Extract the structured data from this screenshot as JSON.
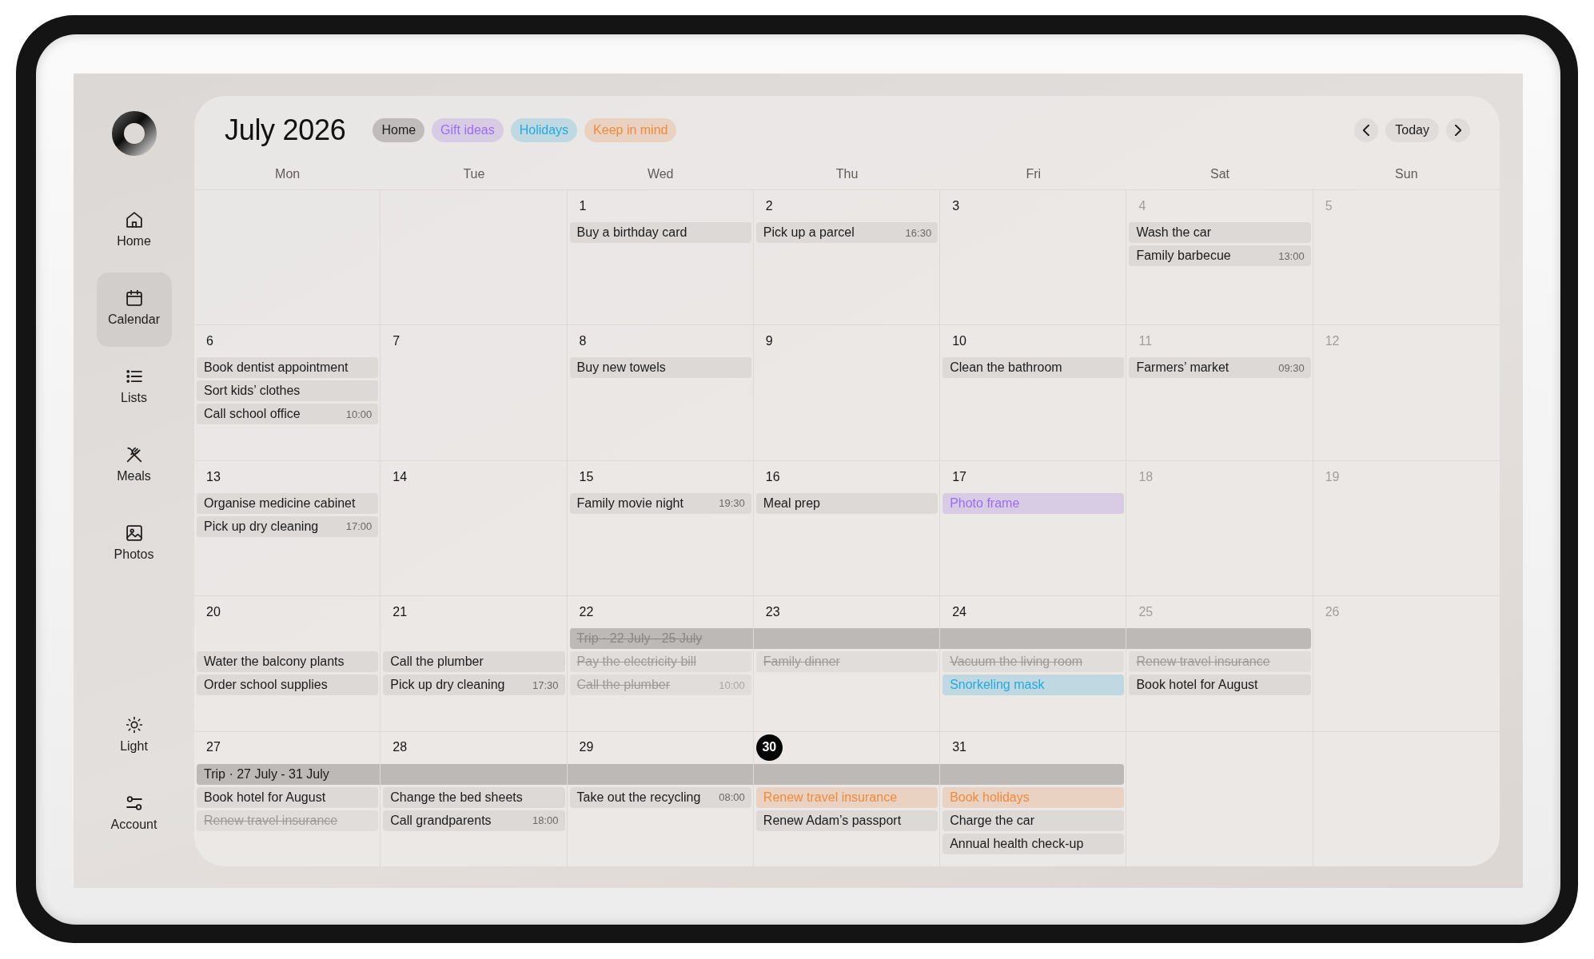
{
  "sidebar": {
    "items": [
      {
        "label": "Home",
        "selected": false
      },
      {
        "label": "Calendar",
        "selected": true
      },
      {
        "label": "Lists",
        "selected": false
      },
      {
        "label": "Meals",
        "selected": false
      },
      {
        "label": "Photos",
        "selected": false
      }
    ],
    "footer_items": [
      {
        "label": "Light"
      },
      {
        "label": "Account"
      }
    ]
  },
  "header": {
    "title": "July 2026",
    "categories": [
      {
        "label": "Home",
        "color": "#1d1d1d"
      },
      {
        "label": "Gift ideas",
        "color": "#9b6cf3"
      },
      {
        "label": "Holidays",
        "color": "#22aadf"
      },
      {
        "label": "Keep in mind",
        "color": "#f08a3c"
      }
    ],
    "today_button": "Today"
  },
  "calendar": {
    "weekdays": [
      "Mon",
      "Tue",
      "Wed",
      "Thu",
      "Fri",
      "Sat",
      "Sun"
    ],
    "weeks": [
      {
        "days": [
          {
            "kind": "blank"
          },
          {
            "kind": "blank"
          },
          {
            "kind": "day",
            "number": "1",
            "weekend": false,
            "today": false,
            "events": [
              {
                "title": "Buy a birthday card",
                "done": false
              }
            ]
          },
          {
            "kind": "day",
            "number": "2",
            "weekend": false,
            "today": false,
            "events": [
              {
                "title": "Pick up a parcel",
                "time": "16:30",
                "done": false
              }
            ]
          },
          {
            "kind": "day",
            "number": "3",
            "weekend": false,
            "today": false
          },
          {
            "kind": "day",
            "number": "4",
            "weekend": true,
            "today": false,
            "events": [
              {
                "title": "Wash the car",
                "done": false
              },
              {
                "title": "Family barbecue",
                "time": "13:00",
                "done": false
              }
            ]
          },
          {
            "kind": "day",
            "number": "5",
            "weekend": true,
            "today": false
          }
        ]
      },
      {
        "days": [
          {
            "kind": "day",
            "number": "6",
            "weekend": false,
            "today": false,
            "events": [
              {
                "title": "Book dentist appointment",
                "done": false
              },
              {
                "title": "Sort kids’ clothes",
                "done": false
              },
              {
                "title": "Call school office",
                "time": "10:00",
                "done": false
              }
            ]
          },
          {
            "kind": "day",
            "number": "7",
            "weekend": false,
            "today": false
          },
          {
            "kind": "day",
            "number": "8",
            "weekend": false,
            "today": false,
            "events": [
              {
                "title": "Buy new towels",
                "done": false
              }
            ]
          },
          {
            "kind": "day",
            "number": "9",
            "weekend": false,
            "today": false
          },
          {
            "kind": "day",
            "number": "10",
            "weekend": false,
            "today": false,
            "events": [
              {
                "title": "Clean the bathroom",
                "done": false
              }
            ]
          },
          {
            "kind": "day",
            "number": "11",
            "weekend": true,
            "today": false,
            "events": [
              {
                "title": "Farmers’ market",
                "time": "09:30",
                "done": false
              }
            ]
          },
          {
            "kind": "day",
            "number": "12",
            "weekend": true,
            "today": false
          }
        ]
      },
      {
        "days": [
          {
            "kind": "day",
            "number": "13",
            "weekend": false,
            "today": false,
            "events": [
              {
                "title": "Organise medicine cabinet",
                "done": false
              },
              {
                "title": "Pick up dry cleaning",
                "time": "17:00",
                "done": false
              }
            ]
          },
          {
            "kind": "day",
            "number": "14",
            "weekend": false,
            "today": false
          },
          {
            "kind": "day",
            "number": "15",
            "weekend": false,
            "today": false,
            "events": [
              {
                "title": "Family movie night",
                "time": "19:30",
                "done": false
              }
            ]
          },
          {
            "kind": "day",
            "number": "16",
            "weekend": false,
            "today": false,
            "events": [
              {
                "title": "Meal prep",
                "done": false
              }
            ]
          },
          {
            "kind": "day",
            "number": "17",
            "weekend": false,
            "today": false,
            "events": [
              {
                "title": "Photo frame",
                "done": false,
                "color": "#9b6cf3"
              }
            ]
          },
          {
            "kind": "day",
            "number": "18",
            "weekend": true,
            "today": false
          },
          {
            "kind": "day",
            "number": "19",
            "weekend": true,
            "today": false
          }
        ]
      },
      {
        "days": [
          {
            "kind": "day",
            "number": "20",
            "weekend": false,
            "today": false,
            "events": [
              {
                "title": "Water the balcony plants",
                "done": false
              },
              {
                "title": "Order school supplies",
                "done": false
              }
            ]
          },
          {
            "kind": "day",
            "number": "21",
            "weekend": false,
            "today": false,
            "events": [
              {
                "title": "Call the plumber",
                "done": false
              },
              {
                "title": "Pick up dry cleaning",
                "time": "17:30",
                "done": false
              }
            ]
          },
          {
            "kind": "day",
            "number": "22",
            "weekend": false,
            "today": false,
            "trip": {
              "kind": "start",
              "label": "Trip · 22 July - 25 July",
              "done": true
            },
            "events": [
              {
                "title": "Pay the electricity bill",
                "done": true
              },
              {
                "title": "Call the plumber",
                "time": "10:00",
                "done": true
              }
            ]
          },
          {
            "kind": "day",
            "number": "23",
            "weekend": false,
            "today": false,
            "trip": {
              "kind": "middle"
            },
            "events": [
              {
                "title": "Family dinner",
                "done": true
              }
            ]
          },
          {
            "kind": "day",
            "number": "24",
            "weekend": false,
            "today": false,
            "trip": {
              "kind": "middle"
            },
            "events": [
              {
                "title": "Vacuum the living room",
                "done": true
              },
              {
                "title": "Snorkeling mask",
                "done": false,
                "color": "#22aadf"
              }
            ]
          },
          {
            "kind": "day",
            "number": "25",
            "weekend": true,
            "today": false,
            "trip": {
              "kind": "end"
            },
            "events": [
              {
                "title": "Renew travel insurance",
                "done": true
              },
              {
                "title": "Book hotel for August",
                "done": false
              }
            ]
          },
          {
            "kind": "day",
            "number": "26",
            "weekend": true,
            "today": false
          }
        ]
      },
      {
        "days": [
          {
            "kind": "day",
            "number": "27",
            "weekend": false,
            "today": false,
            "trip": {
              "kind": "start",
              "label": "Trip · 27 July - 31 July",
              "done": false
            },
            "events": [
              {
                "title": "Book hotel for August",
                "done": false
              },
              {
                "title": "Renew travel insurance",
                "done": true
              }
            ]
          },
          {
            "kind": "day",
            "number": "28",
            "weekend": false,
            "today": false,
            "trip": {
              "kind": "middle"
            },
            "events": [
              {
                "title": "Change the bed sheets",
                "done": false
              },
              {
                "title": "Call grandparents",
                "time": "18:00",
                "done": false
              }
            ]
          },
          {
            "kind": "day",
            "number": "29",
            "weekend": false,
            "today": false,
            "trip": {
              "kind": "middle"
            },
            "events": [
              {
                "title": "Take out the recycling",
                "time": "08:00",
                "done": false
              }
            ]
          },
          {
            "kind": "day",
            "number": "30",
            "weekend": false,
            "today": true,
            "trip": {
              "kind": "middle"
            },
            "events": [
              {
                "title": "Renew travel insurance",
                "done": false,
                "color": "#f08a3c"
              },
              {
                "title": "Renew Adam’s passport",
                "done": false
              }
            ]
          },
          {
            "kind": "day",
            "number": "31",
            "weekend": false,
            "today": false,
            "trip": {
              "kind": "end"
            },
            "events": [
              {
                "title": "Book holidays",
                "done": false,
                "color": "#f08a3c"
              },
              {
                "title": "Charge the car",
                "done": false
              },
              {
                "title": "Annual health check-up",
                "done": false
              }
            ]
          },
          {
            "kind": "blank"
          },
          {
            "kind": "blank"
          }
        ]
      }
    ]
  }
}
